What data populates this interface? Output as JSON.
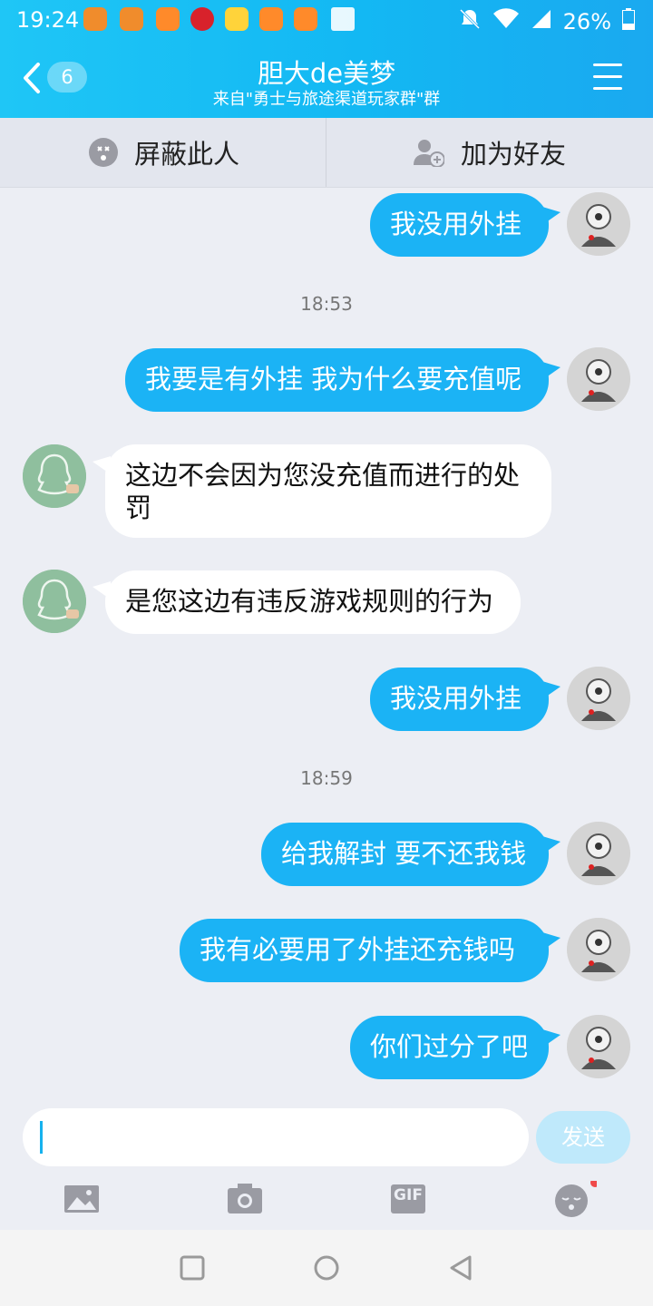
{
  "status": {
    "time": "19:24",
    "battery": "26%"
  },
  "header": {
    "unread_count": "6",
    "title": "胆大de美梦",
    "subtitle": "来自\"勇士与旅途渠道玩家群\"群"
  },
  "actions": {
    "block_label": "屏蔽此人",
    "add_friend_label": "加为好友"
  },
  "messages": [
    {
      "from": "me",
      "text": "我没用外挂"
    },
    {
      "time": "18:53"
    },
    {
      "from": "me",
      "text": "我要是有外挂 我为什么要充值呢"
    },
    {
      "from": "them",
      "text_line1": "这边不会因为您没充值而进行的处",
      "text_line2": "罚"
    },
    {
      "from": "them",
      "text": "是您这边有违反游戏规则的行为"
    },
    {
      "from": "me",
      "text": "我没用外挂"
    },
    {
      "time": "18:59"
    },
    {
      "from": "me",
      "text": "给我解封 要不还我钱"
    },
    {
      "from": "me",
      "text": "我有必要用了外挂还充钱吗"
    },
    {
      "from": "me",
      "text": "你们过分了吧"
    }
  ],
  "composer": {
    "send_label": "发送",
    "tools": [
      "image-icon",
      "camera-icon",
      "gif-icon",
      "emoji-icon"
    ],
    "gif_label": "GIF"
  },
  "colors": {
    "accent": "#1bb3f5",
    "header": "#13b8f3",
    "bubble_other": "#ffffff"
  }
}
